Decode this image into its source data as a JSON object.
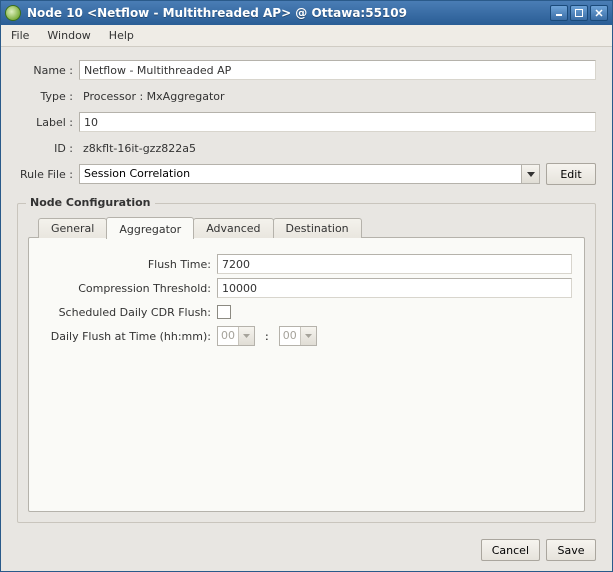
{
  "titlebar": {
    "title": "Node 10 <Netflow - Multithreaded AP> @ Ottawa:55109"
  },
  "menu": {
    "file": "File",
    "window": "Window",
    "help": "Help"
  },
  "form": {
    "name_label": "Name :",
    "name_value": "Netflow - Multithreaded AP",
    "type_label": "Type :",
    "type_value": "Processor : MxAggregator",
    "label_label": "Label :",
    "label_value": "10",
    "id_label": "ID :",
    "id_value": "z8kflt-16it-gzz822a5",
    "rulefile_label": "Rule File :",
    "rulefile_value": "Session Correlation",
    "edit_btn": "Edit"
  },
  "config": {
    "legend": "Node Configuration",
    "tabs": {
      "general": "General",
      "aggregator": "Aggregator",
      "advanced": "Advanced",
      "destination": "Destination"
    },
    "panel": {
      "flush_time_label": "Flush Time:",
      "flush_time_value": "7200",
      "compression_label": "Compression Threshold:",
      "compression_value": "10000",
      "scheduled_label": "Scheduled Daily CDR Flush:",
      "time_label": "Daily Flush at Time (hh:mm):",
      "hh": "00",
      "mm": "00"
    }
  },
  "buttons": {
    "cancel": "Cancel",
    "save": "Save"
  }
}
